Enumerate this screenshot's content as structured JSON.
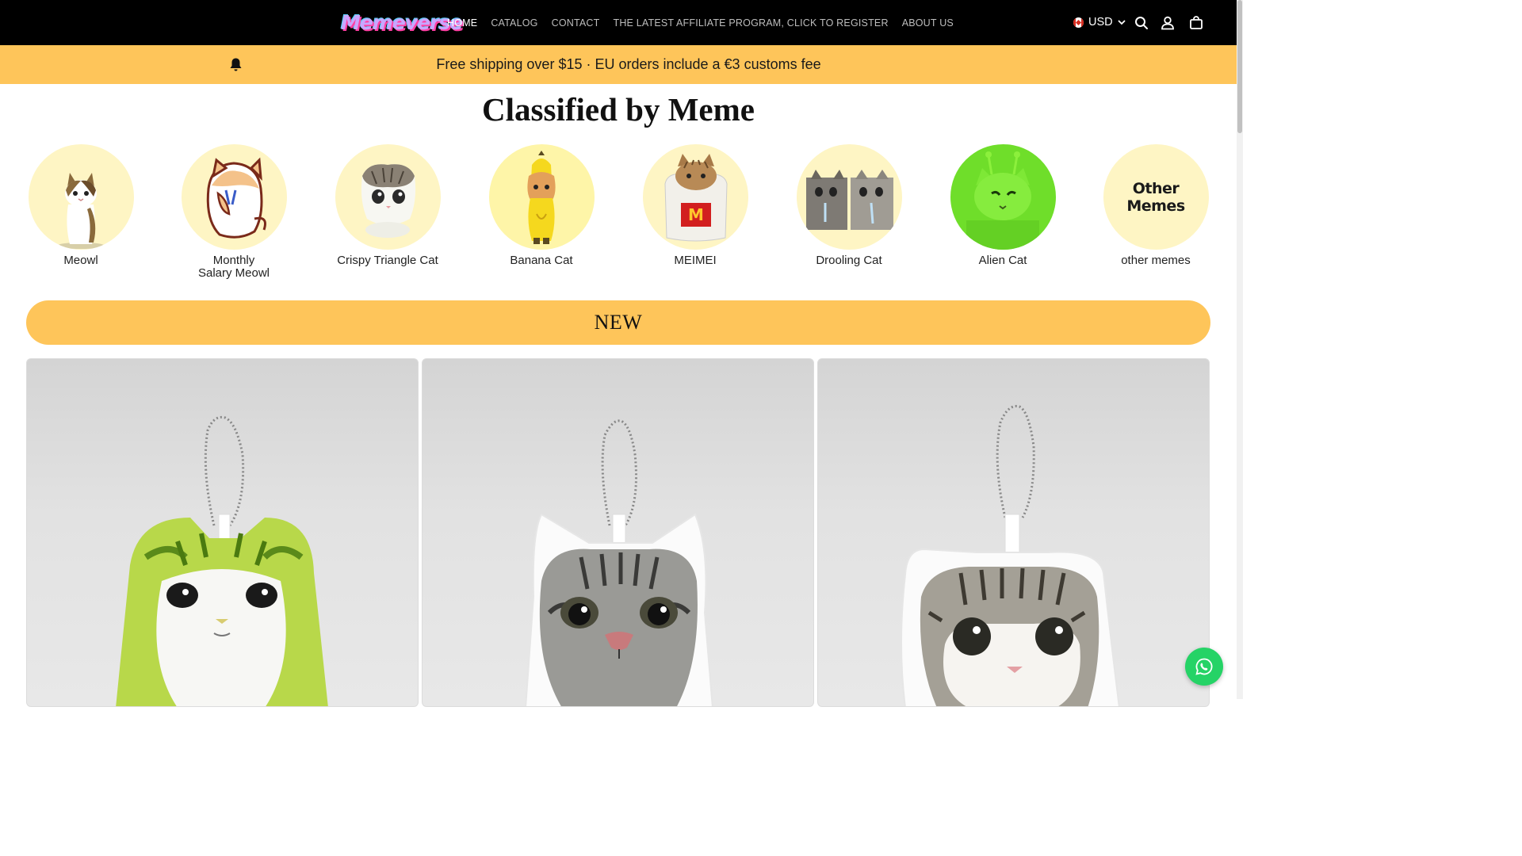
{
  "header": {
    "logo_text": "Memeverse",
    "nav": [
      {
        "label": "HOME",
        "active": true
      },
      {
        "label": "CATALOG",
        "active": false
      },
      {
        "label": "CONTACT",
        "active": false
      },
      {
        "label": "THE LATEST AFFILIATE PROGRAM, CLICK TO REGISTER",
        "active": false
      },
      {
        "label": "ABOUT US",
        "active": false
      }
    ],
    "currency": "USD",
    "icons": [
      "search-icon",
      "account-icon",
      "cart-icon"
    ]
  },
  "announcement": {
    "text": "Free shipping over $15 · EU orders include a €3 customs fee",
    "icon": "bell-icon",
    "background": "#fec55a"
  },
  "categories_section": {
    "title": "Classified by Meme",
    "items": [
      {
        "label": "Meowl"
      },
      {
        "label": "Monthly Salary Meowl"
      },
      {
        "label": "Crispy Triangle Cat"
      },
      {
        "label": "Banana Cat"
      },
      {
        "label": "MEIMEI"
      },
      {
        "label": "Drooling Cat"
      },
      {
        "label": "Alien Cat"
      },
      {
        "label": "other memes",
        "circle_text": "Other Memes"
      }
    ]
  },
  "new_section": {
    "title": "NEW"
  },
  "products": [
    {
      "image": "green-cat-keychain-plush"
    },
    {
      "image": "gray-tabby-cat-keychain-plush"
    },
    {
      "image": "crispy-triangle-cat-keychain-plush"
    }
  ],
  "colors": {
    "header_bg": "#000000",
    "accent": "#fec55a",
    "category_circle": "#fef5c4",
    "whatsapp": "#25d366"
  }
}
